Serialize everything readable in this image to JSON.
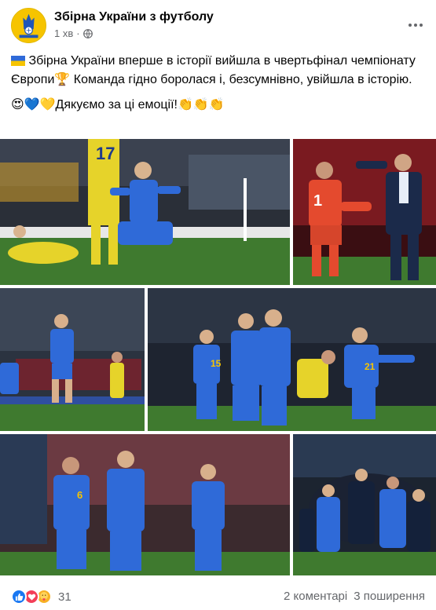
{
  "post": {
    "page_name": "Збірна України з футболу",
    "time": "1 хв",
    "separator": "·",
    "text_line1_prefix": "🇺🇦",
    "text_line1": "Збірна України вперше в історії вийшла в чвертьфінал чемпіонату Європи🏆 Команда гідно боролася і, безсумнівно, увійшла в історію.",
    "text_line2_emojis": "😍💙💛",
    "text_line2": "Дякуємо за ці емоції!👏👏👏"
  },
  "photos": [
    {
      "label": "player-celebrating-on-knees"
    },
    {
      "label": "coach-and-goalkeeper-celebrating"
    },
    {
      "label": "player-running-in-stadium"
    },
    {
      "label": "players-celebrating-group"
    },
    {
      "label": "players-walking-on-pitch"
    },
    {
      "label": "team-huddle-celebration"
    }
  ],
  "photo_jersey": {
    "jersey_17": "17",
    "jersey_1": "1",
    "jersey_15": "15",
    "jersey_21": "21",
    "jersey_6": "6"
  },
  "footer": {
    "reaction_count": "31",
    "comments": "2 коментарі",
    "shares": "3 поширення"
  },
  "colors": {
    "ukraine_blue": "#2f6ad8",
    "ukraine_yellow": "#f6c400",
    "sweden_yellow": "#e6d32a",
    "pitch_green": "#3f7a2f",
    "muted_text": "#65676b"
  }
}
